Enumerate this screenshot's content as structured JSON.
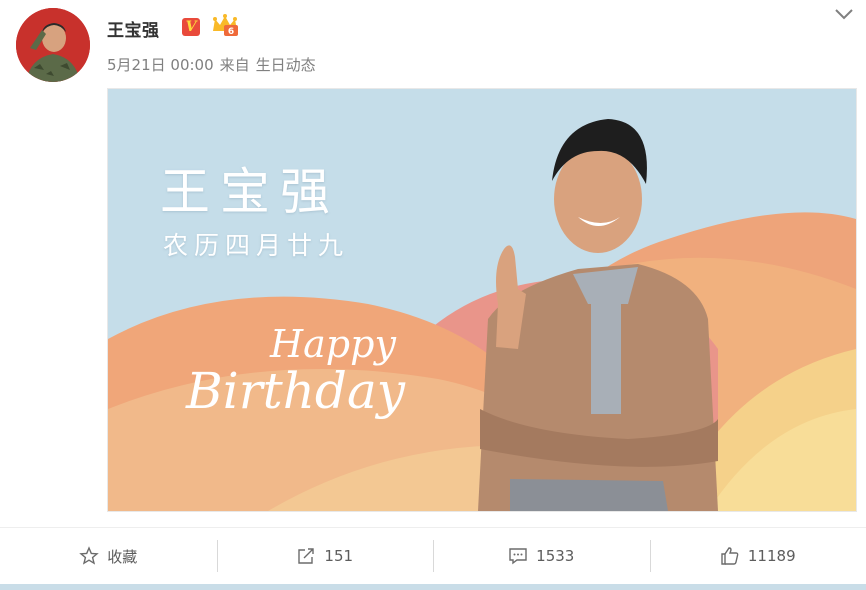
{
  "post": {
    "author": "王宝强",
    "verified_badge": "V",
    "time": "5月21日 00:00",
    "via": "来自",
    "source": "生日动态",
    "avatar_icon": "avatar-soldier-salute",
    "more_icon": "chevron-down-icon"
  },
  "banner": {
    "title": "王宝强",
    "subtitle": "农历四月廿九",
    "happy": "Happy",
    "birthday": "Birthday",
    "colors": {
      "sky": "#c5dde9",
      "hill_peach": "#efa981",
      "hill_light": "#f3c596",
      "hill_yellow": "#f6d087"
    }
  },
  "actions": [
    {
      "label": "收藏",
      "icon": "star-icon"
    },
    {
      "label": "151",
      "icon": "share-icon"
    },
    {
      "label": "1533",
      "icon": "comment-icon"
    },
    {
      "label": "11189",
      "icon": "thumbs-up-icon"
    }
  ]
}
